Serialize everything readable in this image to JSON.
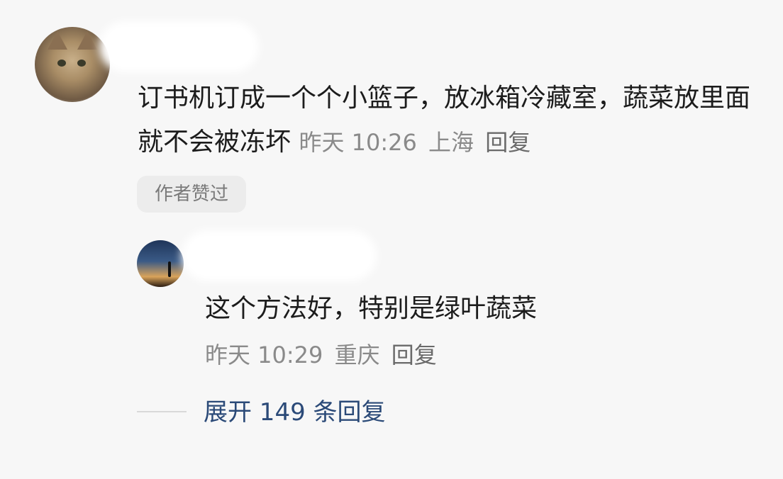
{
  "comment": {
    "text": "订书机订成一个个小篮子，放冰箱冷藏室，蔬菜放里面就不会被冻坏",
    "time": "昨天 10:26",
    "location": "上海",
    "reply_label": "回复",
    "badge": "作者赞过"
  },
  "reply": {
    "text": "这个方法好，特别是绿叶蔬菜",
    "time": "昨天 10:29",
    "location": "重庆",
    "reply_label": "回复"
  },
  "expand": {
    "label": "展开 149 条回复"
  }
}
